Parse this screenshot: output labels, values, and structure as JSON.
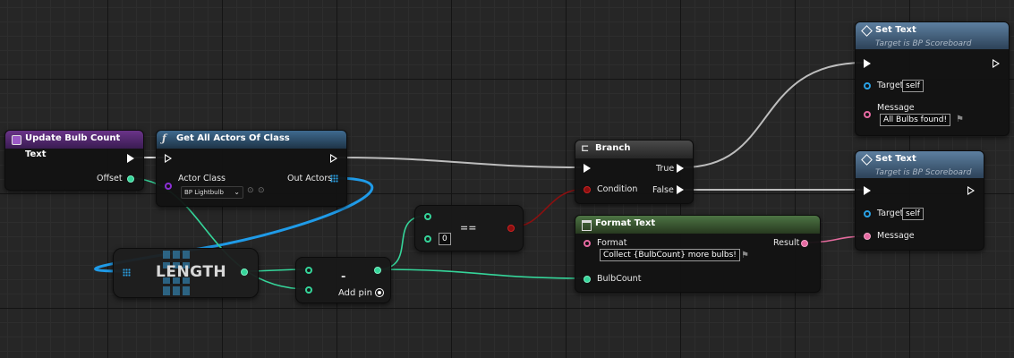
{
  "colors": {
    "event_header": "#5b2a78",
    "function_header": "#2e4f6b",
    "branch_header": "#3a3a3a",
    "format_header": "#3b5a34",
    "settext_header": "#3d5a76",
    "exec_wire": "#dcdcdc",
    "int_wire": "#35d59a",
    "array_wire": "#1f9be8",
    "bool_wire": "#8a1010",
    "text_wire": "#e26a9c"
  },
  "nodes": {
    "update_event": {
      "title": "Update Bulb Count Text",
      "offset_label": "Offset"
    },
    "get_all_actors": {
      "title": "Get All Actors Of Class",
      "actor_class_label": "Actor Class",
      "actor_class_value": "BP Lightbulb",
      "out_actors_label": "Out Actors"
    },
    "length": {
      "title": "LENGTH"
    },
    "subtract": {
      "op": "-",
      "add_pin_label": "Add pin"
    },
    "equals": {
      "op": "==",
      "value": "0"
    },
    "branch": {
      "title": "Branch",
      "condition_label": "Condition",
      "true_label": "True",
      "false_label": "False"
    },
    "format_text": {
      "title": "Format Text",
      "format_label": "Format",
      "format_value": "Collect {BulbCount} more bulbs!",
      "result_label": "Result",
      "bulbcount_label": "BulbCount"
    },
    "set_text_1": {
      "title": "Set Text",
      "subtitle": "Target is BP Scoreboard",
      "target_label": "Target",
      "target_value": "self",
      "message_label": "Message",
      "message_value": "All Bulbs found!"
    },
    "set_text_2": {
      "title": "Set Text",
      "subtitle": "Target is BP Scoreboard",
      "target_label": "Target",
      "target_value": "self",
      "message_label": "Message"
    }
  }
}
